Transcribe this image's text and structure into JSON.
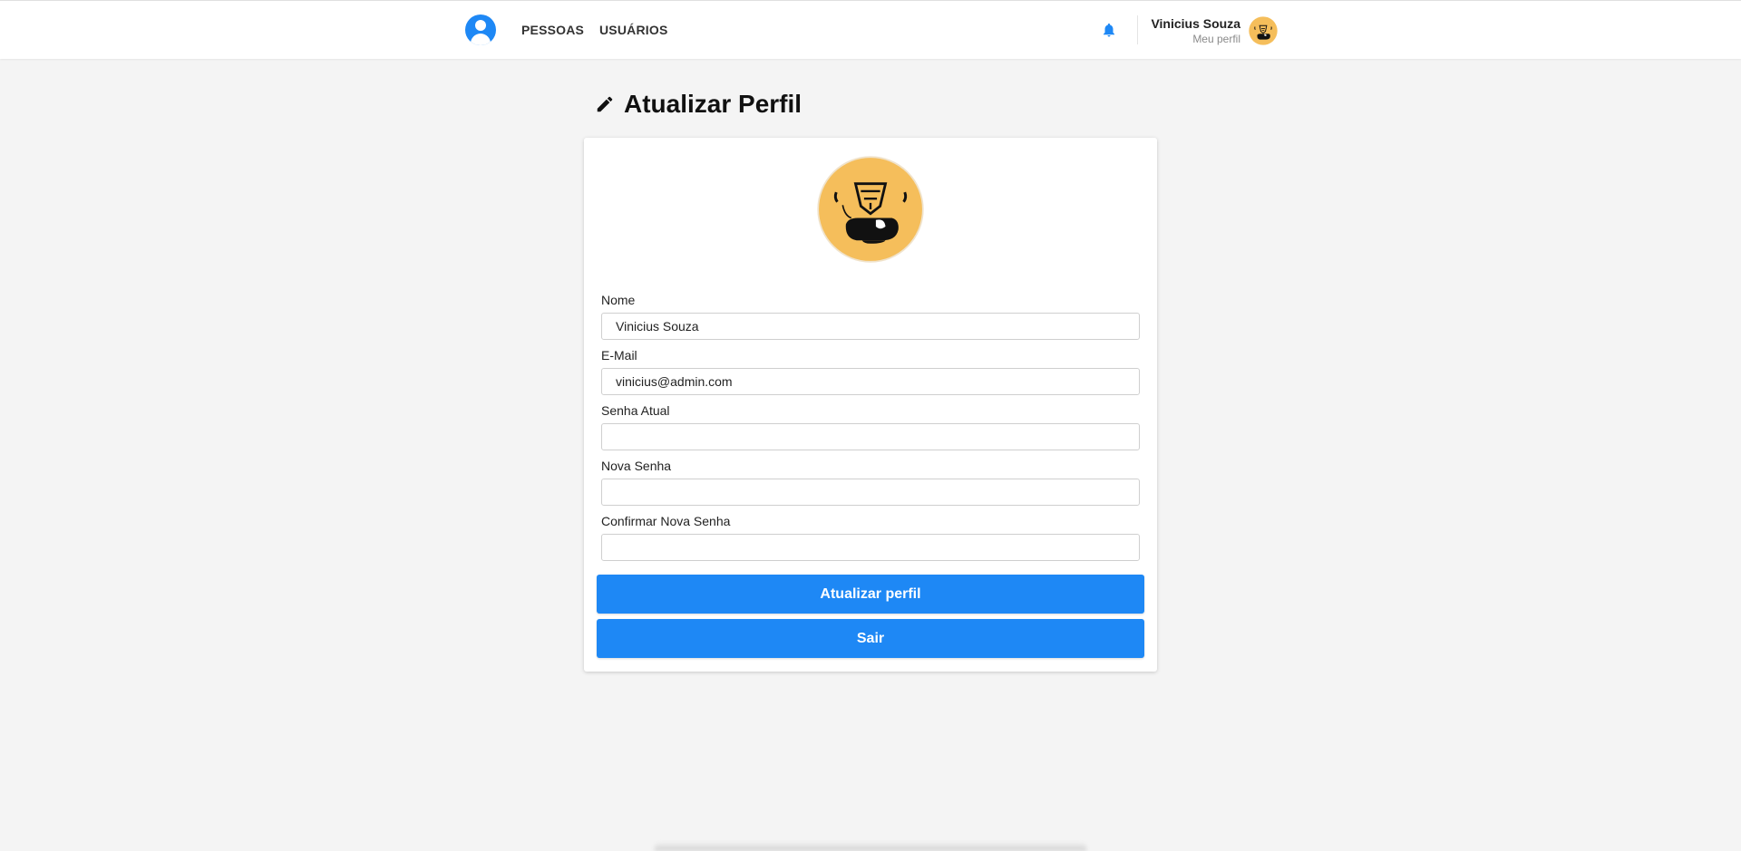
{
  "nav": {
    "items": [
      {
        "label": "PESSOAS"
      },
      {
        "label": "USUÁRIOS"
      }
    ]
  },
  "user": {
    "name": "Vinicius Souza",
    "subtitle": "Meu perfil"
  },
  "page": {
    "title": "Atualizar Perfil"
  },
  "form": {
    "fields": [
      {
        "label": "Nome",
        "value": "Vinicius Souza"
      },
      {
        "label": "E-Mail",
        "value": "vinicius@admin.com"
      },
      {
        "label": "Senha Atual",
        "value": ""
      },
      {
        "label": "Nova Senha",
        "value": ""
      },
      {
        "label": "Confirmar Nova Senha",
        "value": ""
      }
    ],
    "submit_label": "Atualizar perfil",
    "logout_label": "Sair"
  },
  "icons": {
    "logo": "user-circle-icon",
    "bell": "bell-icon",
    "title": "pencil-icon"
  },
  "colors": {
    "accent": "#1e88f5",
    "avatar_bg": "#f5be5b"
  }
}
